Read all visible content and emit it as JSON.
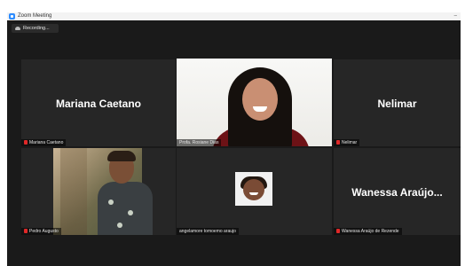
{
  "window": {
    "title": "Zoom Meeting",
    "minimize_glyph": "–"
  },
  "recording": {
    "label": "Recording..."
  },
  "colors": {
    "active_speaker_border": "#9bcc3c",
    "muted_mic": "#e02828",
    "meeting_background": "#1a1a1a",
    "tile_background": "#262626"
  },
  "participants": [
    {
      "display_name": "Mariana Caetano",
      "label": "Mariana Caetano",
      "muted": true,
      "video": false
    },
    {
      "display_name": "",
      "label": "Profa. Rosiane Dias",
      "muted": true,
      "video": true,
      "active_speaker": true
    },
    {
      "display_name": "Nelimar",
      "label": "Nelimar",
      "muted": true,
      "video": false
    },
    {
      "display_name": "",
      "label": "Pedro Augusto",
      "muted": true,
      "video": true
    },
    {
      "display_name": "",
      "label": "angelamore tomoemo araujo",
      "muted": false,
      "video": false,
      "profile_photo": true
    },
    {
      "display_name": "Wanessa  Araújo...",
      "label": "Wanessa Araújo de Rezende",
      "muted": true,
      "video": false
    }
  ],
  "icons": [
    "zoom-app-icon",
    "recording-icon",
    "muted-mic-icon",
    "minimize-icon"
  ]
}
